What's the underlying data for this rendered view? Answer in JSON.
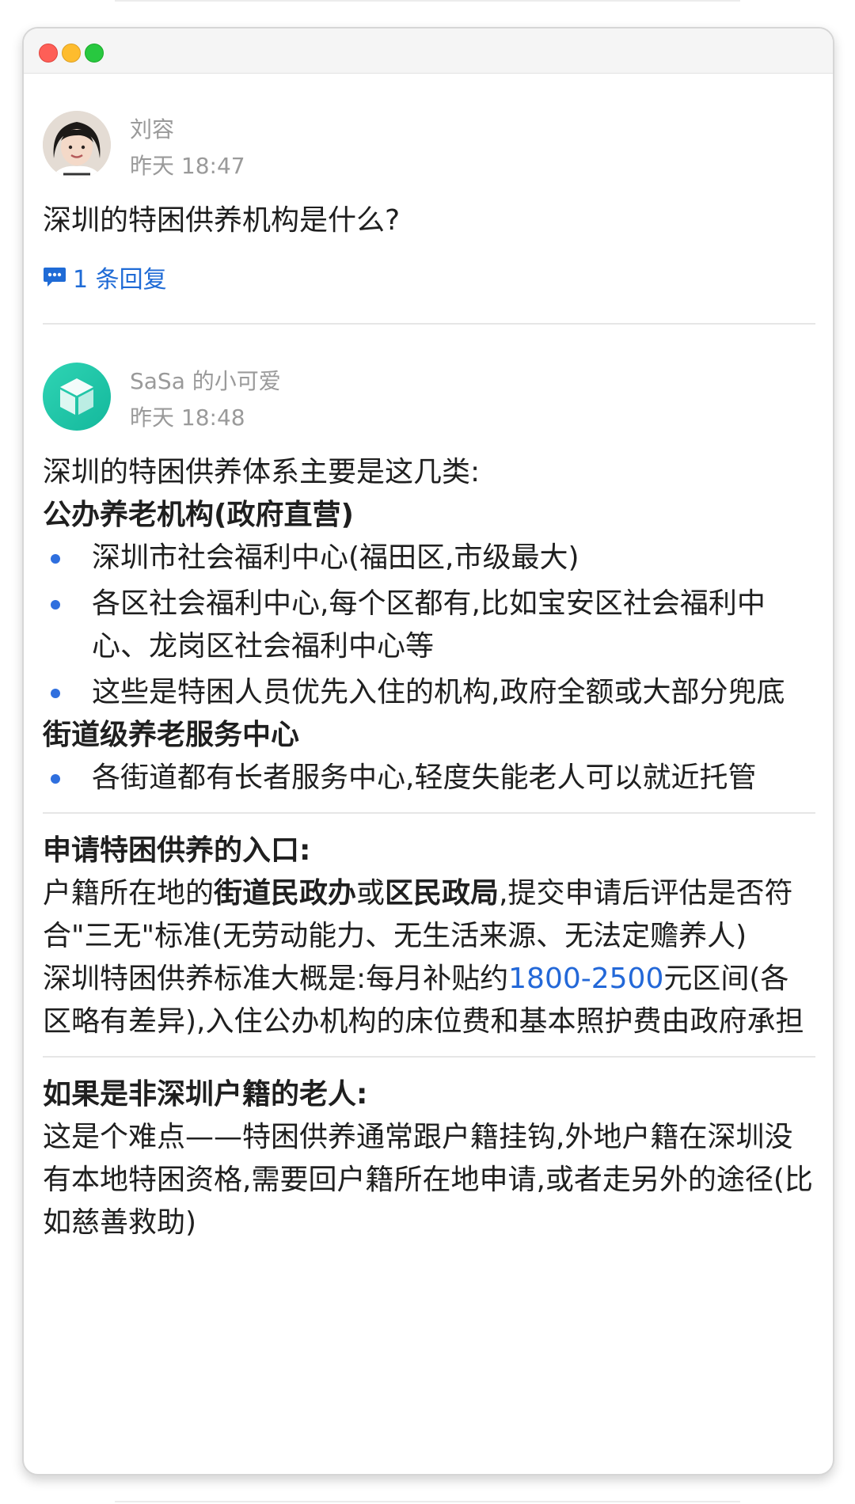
{
  "window": {
    "controls": [
      "close",
      "minimize",
      "maximize"
    ]
  },
  "question": {
    "author": "刘容",
    "time": "昨天 18:47",
    "text": "深圳的特困供养机构是什么?",
    "reply_count": "1 条回复"
  },
  "answer": {
    "author": "SaSa 的小可爱",
    "time": "昨天 18:48",
    "intro": "深圳的特困供养体系主要是这几类:",
    "section1": {
      "heading": "公办养老机构(政府直营)",
      "items": [
        "深圳市社会福利中心(福田区,市级最大)",
        "各区社会福利中心,每个区都有,比如宝安区社会福利中心、龙岗区社会福利中心等",
        "这些是特困人员优先入住的机构,政府全额或大部分兜底"
      ]
    },
    "section2": {
      "heading": "街道级养老服务中心",
      "items": [
        "各街道都有长者服务中心,轻度失能老人可以就近托管"
      ]
    },
    "section3": {
      "heading": "申请特困供养的入口:",
      "p1_a": "户籍所在地的",
      "p1_b": "街道民政办",
      "p1_c": "或",
      "p1_d": "区民政局",
      "p1_e": ",提交申请后评估是否符合\"三无\"标准(无劳动能力、无生活来源、无法定赡养人)",
      "p2_a": "深圳特困供养标准大概是:每月补贴约",
      "p2_link": "1800-2500",
      "p2_b": "元区间(各区略有差异),入住公办机构的床位费和基本照护费由政府承担"
    },
    "section4": {
      "heading": "如果是非深圳户籍的老人:",
      "text": "这是个难点——特困供养通常跟户籍挂钩,外地户籍在深圳没有本地特困资格,需要回户籍所在地申请,或者走另外的途径(比如慈善救助)"
    }
  },
  "colors": {
    "accent": "#1f6bd6",
    "bullet": "#2f6fde",
    "meta": "#9a9a9a"
  },
  "icons": {
    "reply": "chat-bubble-icon",
    "avatar_answer": "cube-icon"
  }
}
